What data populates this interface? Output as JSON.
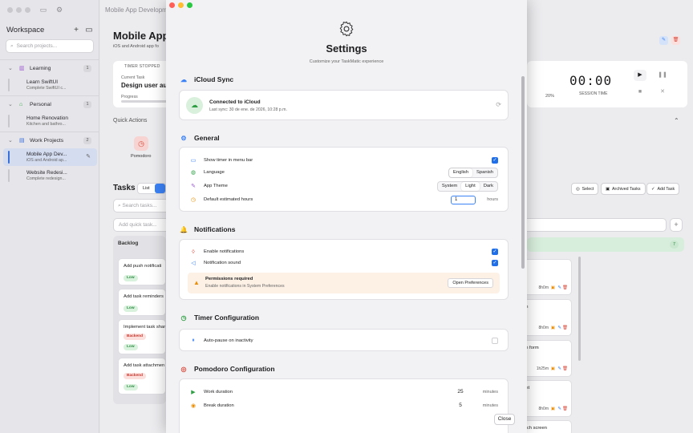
{
  "sidebar": {
    "title": "Workspace",
    "search_placeholder": "Search projects...",
    "groups": [
      {
        "label": "Learning",
        "count": "1",
        "projects": [
          {
            "title": "Learn SwiftUI",
            "subtitle": "Complete SwiftUI c..."
          }
        ]
      },
      {
        "label": "Personal",
        "count": "1",
        "projects": [
          {
            "title": "Home Renovation",
            "subtitle": "Kitchen and bathro..."
          }
        ]
      },
      {
        "label": "Work Projects",
        "count": "2",
        "projects": [
          {
            "title": "Mobile App Dev...",
            "subtitle": "iOS and Android ap..."
          },
          {
            "title": "Website Redesi...",
            "subtitle": "Complete redesign..."
          }
        ]
      }
    ]
  },
  "main": {
    "window_title": "Mobile App Developm",
    "project_title": "Mobile App",
    "project_sub": "iOS and Android app fo",
    "timer_status": "TIMER STOPPED",
    "current_task_label": "Current Task",
    "current_task": "Design user aut",
    "progress_label": "Progress",
    "progress_pct": "20%",
    "quick_actions": "Quick Actions",
    "pomodoro": "Pomodoro",
    "clock": "00:00",
    "session_time": "SESSION TIME",
    "tasks_title": "Tasks",
    "view_list": "List",
    "task_search_placeholder": "Search tasks...",
    "quick_add_placeholder": "Add quick task...",
    "select_btn": "Select",
    "archived_btn": "Archived Tasks",
    "add_task_btn": "Add Task",
    "backlog": "Backlog",
    "done_count": "7",
    "backlog_cards": [
      {
        "title": "Add push notificati",
        "tags": [
          "Low"
        ]
      },
      {
        "title": "Add task reminders",
        "tags": [
          "Low"
        ]
      },
      {
        "title": "Implement task shar",
        "tags": [
          "Backend",
          "Low"
        ]
      },
      {
        "title": "Add task attachmen",
        "tags": [
          "Backend",
          "Low"
        ]
      }
    ],
    "right_cards": [
      {
        "title": "w",
        "duration": "8h0m"
      },
      {
        "title": "en",
        "duration": "8h0m"
      },
      {
        "title": "on form",
        "duration": "1h25m"
      },
      {
        "title": "ent",
        "duration": "8h0m"
      },
      {
        "title": "ntch screen",
        "duration": ""
      }
    ]
  },
  "settings": {
    "title": "Settings",
    "subtitle": "Customize your TaskMatic experience",
    "icloud": {
      "header": "iCloud Sync",
      "status": "Connected to iCloud",
      "last_sync": "Last sync: 30 de ene. de 2026, 10:28 p.m."
    },
    "general": {
      "header": "General",
      "show_timer": "Show timer in menu bar",
      "language": "Language",
      "language_options": [
        "English",
        "Spanish"
      ],
      "app_theme": "App Theme",
      "theme_options": [
        "System",
        "Light",
        "Dark"
      ],
      "default_hours": "Default estimated hours",
      "default_hours_value": "1",
      "hours_unit": "hours"
    },
    "notifications": {
      "header": "Notifications",
      "enable": "Enable notifications",
      "sound": "Notification sound",
      "perm_title": "Permissions required",
      "perm_sub": "Enable notifications in System Preferences",
      "open_prefs": "Open Preferences"
    },
    "timer": {
      "header": "Timer Configuration",
      "auto_pause": "Auto-pause on inactivity"
    },
    "pomodoro": {
      "header": "Pomodoro Configuration",
      "work": "Work duration",
      "work_value": "25",
      "break": "Break duration",
      "break_value": "5",
      "unit": "minutes"
    },
    "close": "Close"
  },
  "colors": {
    "accent": "#1f6feb",
    "danger": "#d64a3c",
    "success": "#2f9e44",
    "warning": "#e8900c"
  }
}
